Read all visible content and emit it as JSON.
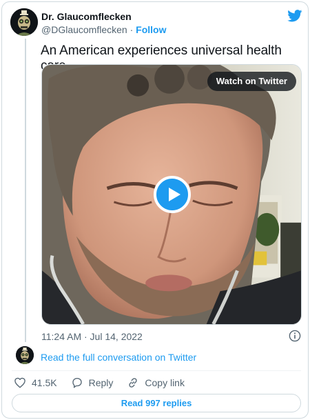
{
  "tweet": {
    "author_name": "Dr. Glaucomflecken",
    "handle": "@DGlaucomflecken",
    "separator": " · ",
    "follow_label": "Follow",
    "text": "An American experiences universal health care",
    "timestamp": "11:24 AM · Jul 14, 2022"
  },
  "media": {
    "watch_label": "Watch on Twitter"
  },
  "conversation": {
    "read_full_label": "Read the full conversation on Twitter"
  },
  "actions": {
    "like_count": "41.5K",
    "reply_label": "Reply",
    "copy_link_label": "Copy link"
  },
  "footer": {
    "read_replies_label": "Read 997 replies"
  },
  "icons": {
    "brand": "twitter-bird-icon",
    "info": "info-icon",
    "play": "play-icon",
    "like": "heart-icon",
    "reply": "speech-bubble-icon",
    "copy_link": "link-icon"
  },
  "colors": {
    "accent": "#1d9bf0",
    "text": "#0f1419",
    "secondary": "#536471",
    "border": "#cfd9de"
  }
}
